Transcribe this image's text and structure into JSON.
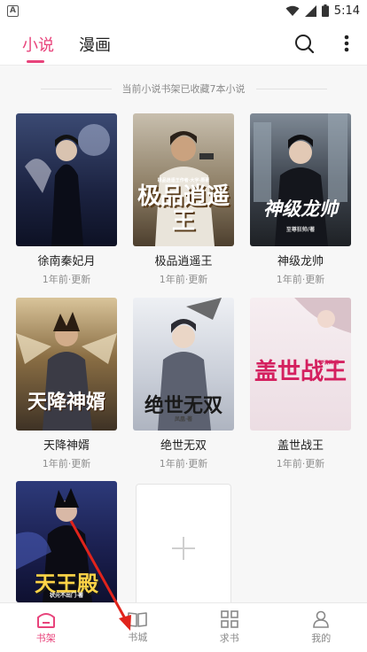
{
  "statusbar": {
    "time": "5:14"
  },
  "header": {
    "tabs": [
      {
        "label": "小说",
        "active": true
      },
      {
        "label": "漫画",
        "active": false
      }
    ]
  },
  "shelf": {
    "count_text": "当前小说书架已收藏7本小说"
  },
  "books": [
    {
      "title": "徐南秦妃月",
      "meta": "1年前·更新",
      "cover_color": "#2a3350"
    },
    {
      "title": "极品逍遥王",
      "meta": "1年前·更新",
      "cover_color": "#8a7a62",
      "cover_text": "极品逍遥王",
      "cover_small": "极品逍遥王作者·大宇·原著"
    },
    {
      "title": "神级龙帅",
      "meta": "1年前·更新",
      "cover_color": "#3a3a42",
      "cover_text": "神级龙帅",
      "cover_small": "至尊狂帅/著"
    },
    {
      "title": "天降神婿",
      "meta": "1年前·更新",
      "cover_color": "#6b5a3e",
      "cover_text": "天降神婿"
    },
    {
      "title": "绝世无双",
      "meta": "1年前·更新",
      "cover_color": "#d9dce3",
      "cover_text": "绝世无双",
      "cover_small": "凤凰·著"
    },
    {
      "title": "盖世战王",
      "meta": "1年前·更新",
      "cover_color": "#f1e6ea",
      "cover_text": "盖世战王",
      "cover_small": "一梦清风·著"
    },
    {
      "title": "天王殿",
      "meta": "",
      "cover_color": "#1d2148",
      "cover_text": "天王殿",
      "cover_small": "状元不出门·著"
    }
  ],
  "bottom_nav": [
    {
      "label": "书架",
      "icon": "bookshelf-icon",
      "active": true
    },
    {
      "label": "书城",
      "icon": "open-book-icon",
      "active": false
    },
    {
      "label": "求书",
      "icon": "grid-icon",
      "active": false
    },
    {
      "label": "我的",
      "icon": "user-icon",
      "active": false
    }
  ],
  "colors": {
    "accent": "#e8437b",
    "annotation_arrow": "#e0241c"
  }
}
